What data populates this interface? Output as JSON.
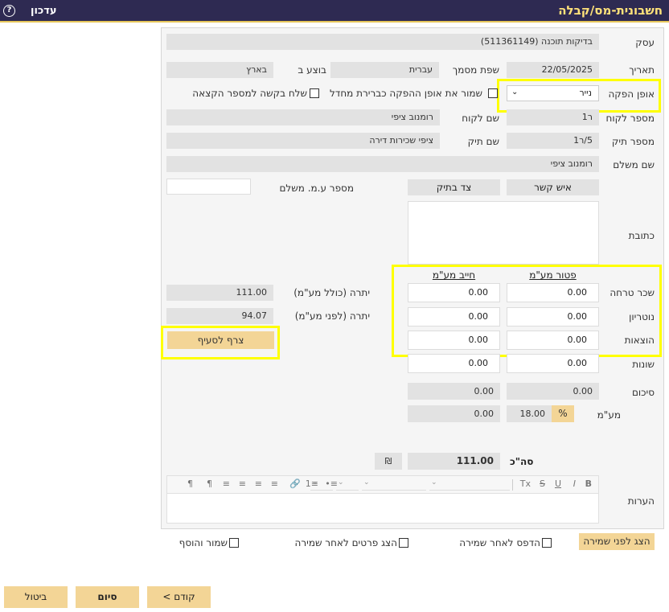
{
  "title": "חשבונית-מס/קבלה",
  "update_label": "עדכון",
  "help_icon": "?",
  "labels": {
    "business": "עסק",
    "date": "תאריך",
    "doc_language": "שפת מסמך",
    "performed_in": "בוצע ב",
    "issue_method": "אופן הפקה",
    "save_issue_default": "שמור את אופן ההפקה כברירת מחדל",
    "send_request": "שלח בקשה למספר הקצאה",
    "customer_number": "מספר לקוח",
    "customer_name": "שם לקוח",
    "file_number": "מספר תיק",
    "file_name": "שם תיק",
    "payer_name": "שם משלם",
    "payer_vat_number": "מספר ע.מ. משלם",
    "address": "כתובת",
    "summary": "סיכום",
    "vat": "מע\"מ",
    "total": "סה\"כ",
    "notes": "הערות",
    "balance_incl_vat": "יתרה (כולל מע\"מ)",
    "balance_excl_vat": "יתרה (לפני מע\"מ)"
  },
  "fields": {
    "business": "בדיקות תוכנה (511361149)",
    "date": "22/05/2025",
    "doc_language": "עברית",
    "performed_in": "בארץ",
    "issue_method": "נייר",
    "customer_number": "ר1",
    "customer_name": "רומנוב ציפי",
    "file_number": "5/ר1",
    "file_name": "ציפי שכירות דירה",
    "payer_name": "רומנוב ציפי",
    "payer_vat_number": ""
  },
  "contact_tabs": [
    "איש קשר",
    "צד בתיק"
  ],
  "amounts": {
    "col_exempt": "פטור מע\"מ",
    "col_taxable": "חייב מע\"מ",
    "rows": [
      {
        "label": "שכר טרחה",
        "exempt": "0.00",
        "taxable": "0.00"
      },
      {
        "label": "נוטריון",
        "exempt": "0.00",
        "taxable": "0.00"
      },
      {
        "label": "הוצאות",
        "exempt": "0.00",
        "taxable": "0.00"
      },
      {
        "label": "שונות",
        "exempt": "0.00",
        "taxable": "0.00"
      }
    ],
    "summary_exempt": "0.00",
    "summary_taxable": "0.00",
    "vat_rate": "18.00",
    "vat_percent_button": "%",
    "vat_amount": "0.00",
    "total": "111.00",
    "currency_symbol": "₪"
  },
  "balances": {
    "incl_vat": "111.00",
    "excl_vat": "94.07"
  },
  "attach_button": "צרף לסעיף",
  "notes_toolbar_icons": [
    "B",
    "I",
    "U",
    "S",
    "Tx",
    "¶",
    "¶",
    "≡",
    "≡",
    "≡",
    "≡",
    "🔗",
    "1≡",
    "•≡"
  ],
  "bottom_options": {
    "preview_before_save": "הצג לפני שמירה",
    "print_after_save": "הדפס לאחר שמירה",
    "show_details_after_save": "הצג פרטים לאחר שמירה",
    "save_and_add": "שמור והוסף"
  },
  "buttons": {
    "previous": "< קודם",
    "finish": "סיום",
    "cancel": "ביטול"
  },
  "colors": {
    "titlebar": "#2e2a52",
    "title_text": "#ffe27a",
    "button_tan": "#f3d596",
    "highlight": "#ffff00"
  }
}
